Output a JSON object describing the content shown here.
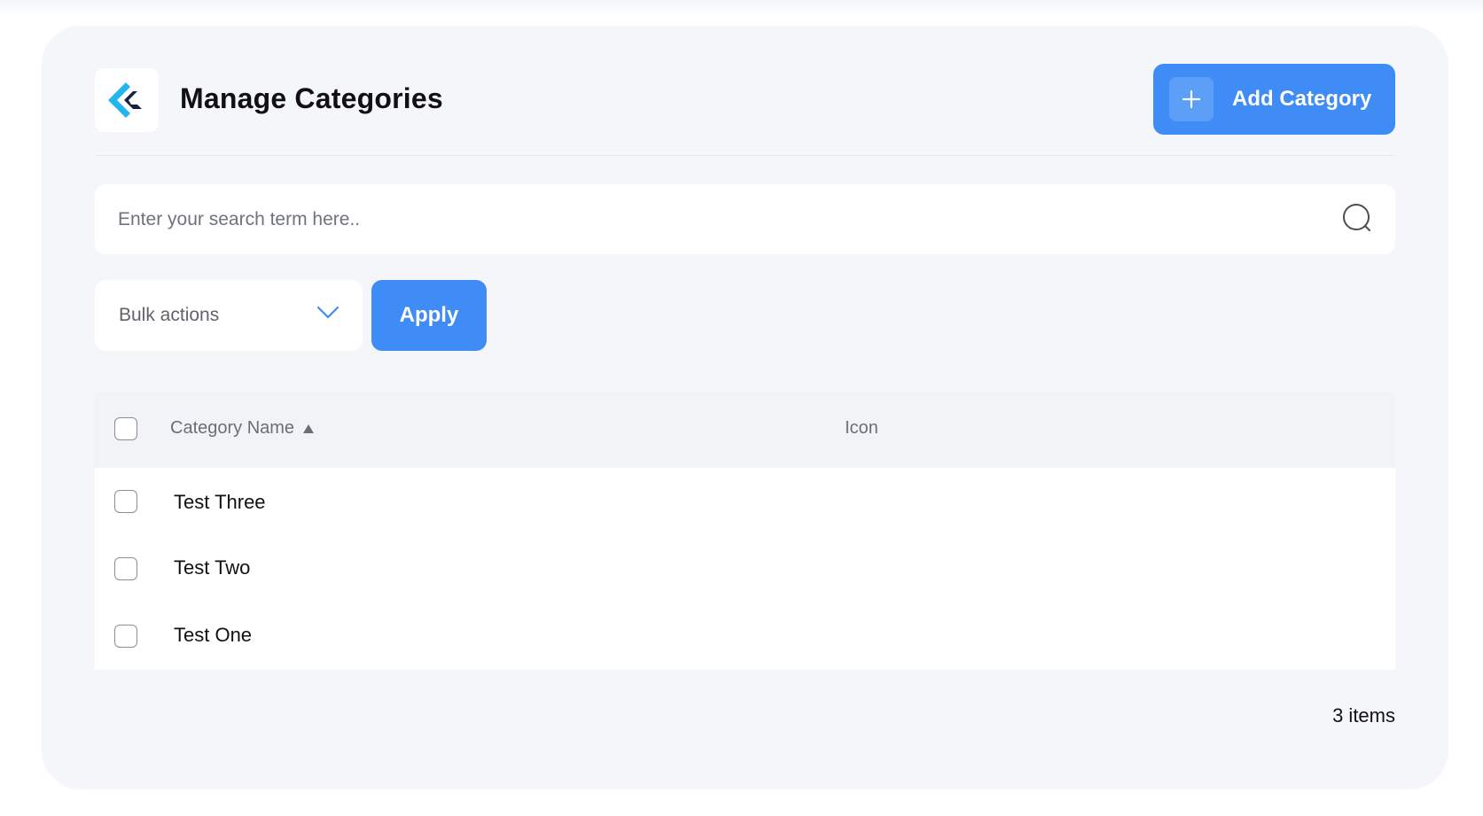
{
  "header": {
    "title": "Manage Categories",
    "add_button_label": "Add Category"
  },
  "search": {
    "placeholder": "Enter your search term here.."
  },
  "bulk": {
    "selected": "Bulk actions",
    "apply_label": "Apply"
  },
  "table": {
    "columns": {
      "name": "Category Name",
      "icon": "Icon"
    },
    "rows": [
      {
        "name": "Test Three"
      },
      {
        "name": "Test Two"
      },
      {
        "name": "Test One"
      }
    ]
  },
  "footer": {
    "count_label": "3 items"
  },
  "icons": {
    "logo": "logo-icon",
    "add": "plus-icon",
    "search": "search-icon",
    "dropdown": "chevron-down-icon",
    "sort": "sort-ascending-icon"
  },
  "colors": {
    "accent": "#3f8cf6",
    "card_background": "#f5f6fa",
    "logo_dark": "#14233b",
    "logo_cyan": "#22b5ee"
  }
}
